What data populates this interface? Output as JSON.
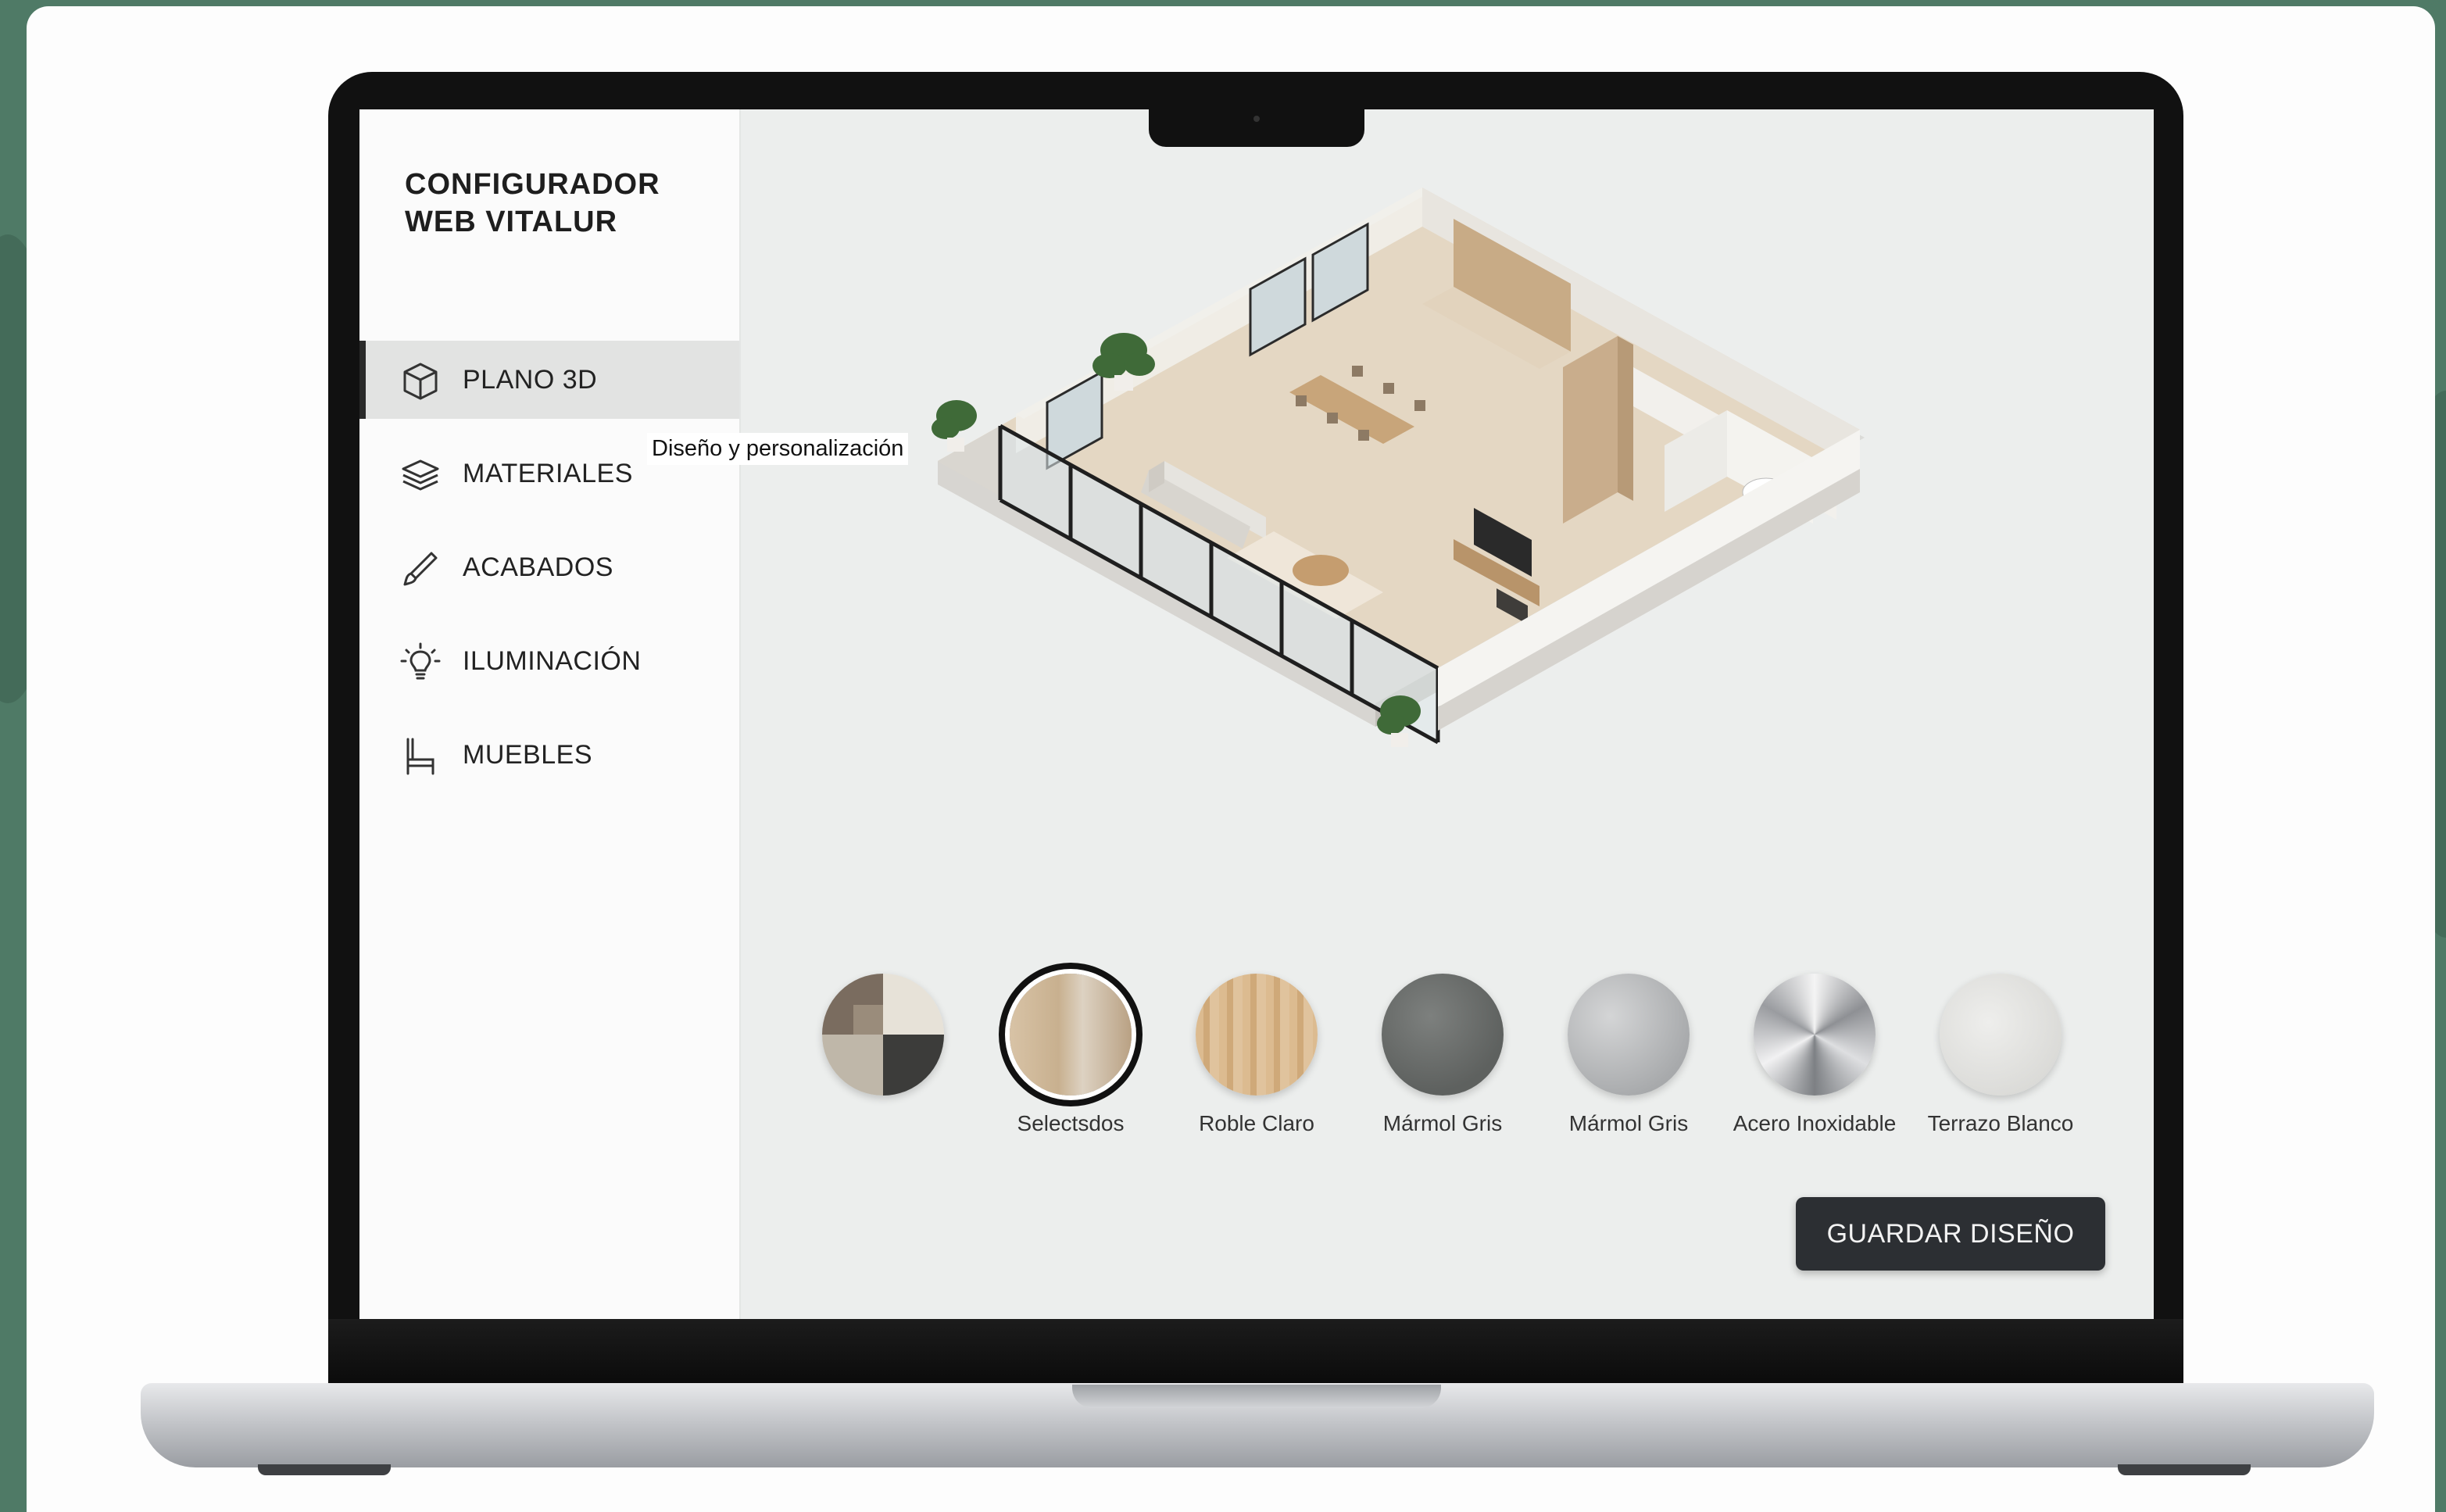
{
  "app": {
    "brand_line1": "CONFIGURADOR",
    "brand_line2": "WEB VITALUR"
  },
  "sidebar": {
    "items": [
      {
        "label": "PLANO 3D",
        "icon": "cube-icon",
        "active": true
      },
      {
        "label": "MATERIALES",
        "icon": "layers-icon",
        "active": false
      },
      {
        "label": "ACABADOS",
        "icon": "brush-icon",
        "active": false
      },
      {
        "label": "ILUMINACIÓN",
        "icon": "lightbulb-icon",
        "active": false
      },
      {
        "label": "MUEBLES",
        "icon": "chair-icon",
        "active": false
      }
    ]
  },
  "tooltip": {
    "text": "Diseño y personalización"
  },
  "materials": {
    "swatches": [
      {
        "label": "",
        "icon": "mixed-materials-swatch",
        "selected": false
      },
      {
        "label": "Selectsdos",
        "color": "#cdb79c",
        "selected": true
      },
      {
        "label": "Roble Claro",
        "color": "#d8b78c",
        "selected": false
      },
      {
        "label": "Mármol Gris",
        "color": "#6f7270",
        "selected": false
      },
      {
        "label": "Mármol Gris",
        "color": "#b9bbbc",
        "selected": false
      },
      {
        "label": "Acero Inoxidable",
        "color": "#a9abae",
        "selected": false
      },
      {
        "label": "Terrazo Blanco",
        "color": "#e4e4e2",
        "selected": false
      }
    ]
  },
  "actions": {
    "save_label": "GUARDAR DISEÑO"
  },
  "colors": {
    "background_green": "#4f7a66",
    "sidebar_active": "#e2e3e2",
    "button_dark": "#2c2f33",
    "screen_bg": "#eceeed"
  }
}
